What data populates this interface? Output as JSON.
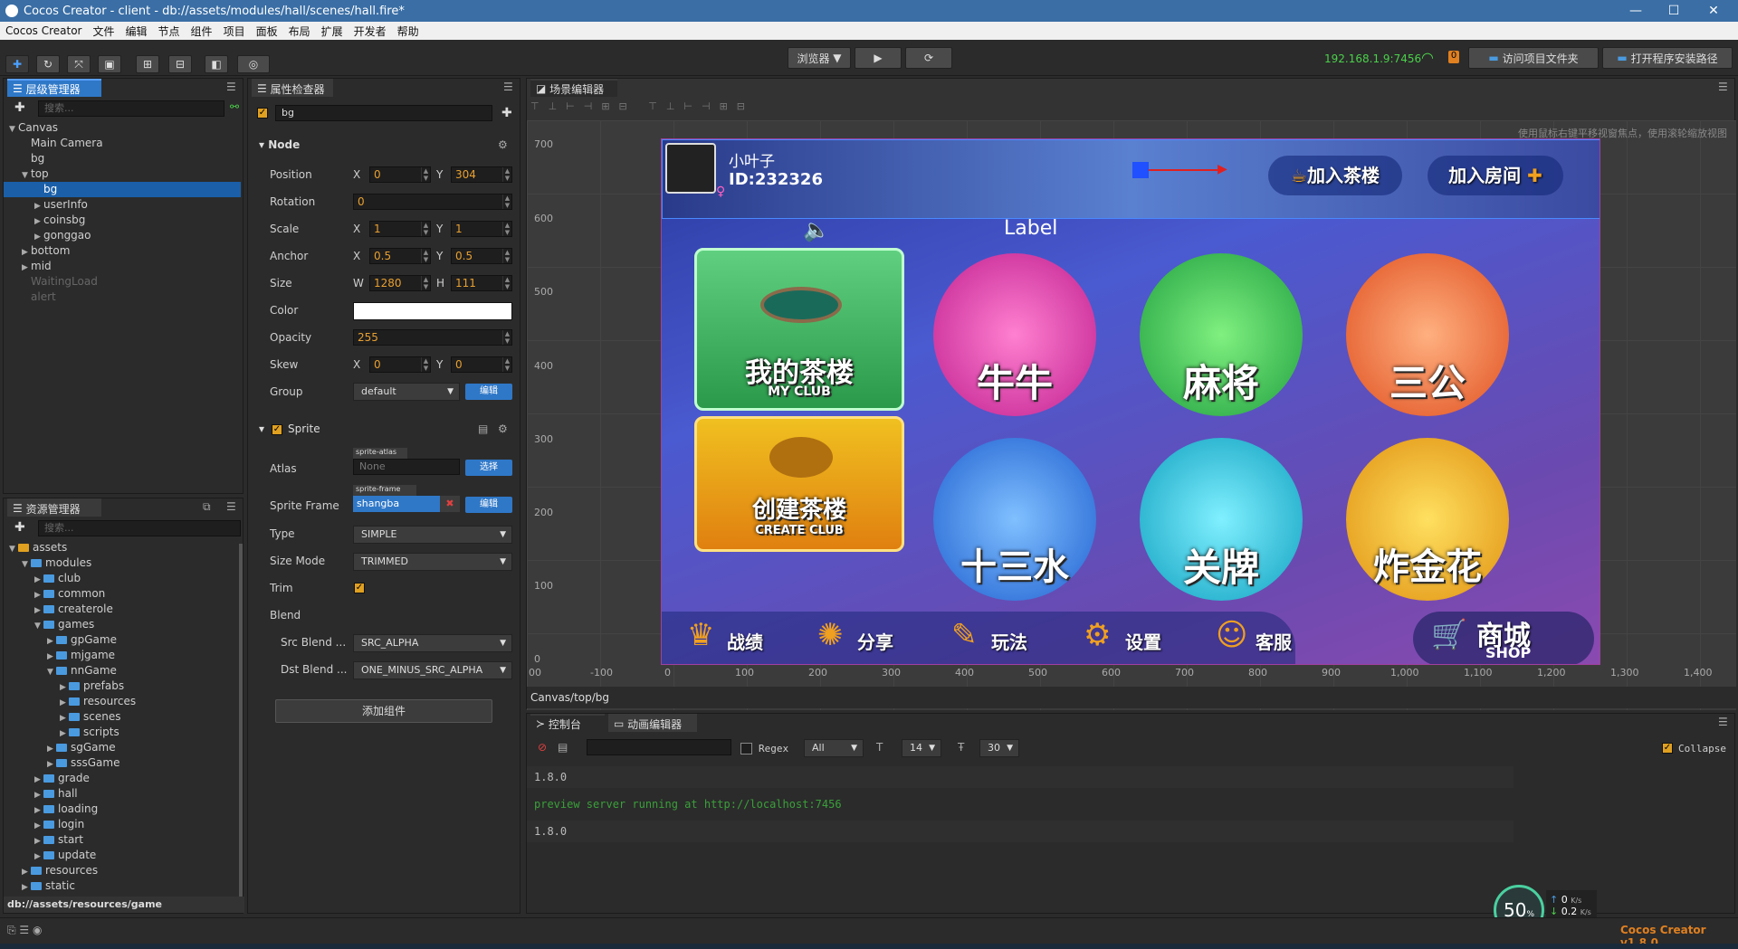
{
  "window": {
    "title": "Cocos Creator - client - db://assets/modules/hall/scenes/hall.fire*",
    "min": "—",
    "max": "☐",
    "close": "✕"
  },
  "menu": [
    "Cocos Creator",
    "文件",
    "编辑",
    "节点",
    "组件",
    "项目",
    "面板",
    "布局",
    "扩展",
    "开发者",
    "帮助"
  ],
  "toolbar": {
    "browser_label": "浏览器",
    "ip": "192.168.1.9:7456",
    "badge": "0",
    "visit_folder": "访问项目文件夹",
    "open_install": "打开程序安装路径"
  },
  "hierarchy": {
    "tab": "层级管理器",
    "search_placeholder": "搜索...",
    "items": [
      {
        "label": "Canvas",
        "arrow": "▼"
      },
      {
        "label": "Main Camera",
        "arrow": ""
      },
      {
        "label": "bg",
        "arrow": ""
      },
      {
        "label": "top",
        "arrow": "▼"
      },
      {
        "label": "bg",
        "arrow": ""
      },
      {
        "label": "userInfo",
        "arrow": "▶"
      },
      {
        "label": "coinsbg",
        "arrow": "▶"
      },
      {
        "label": "gonggao",
        "arrow": "▶"
      },
      {
        "label": "bottom",
        "arrow": "▶"
      },
      {
        "label": "mid",
        "arrow": "▶"
      },
      {
        "label": "WaitingLoad",
        "arrow": ""
      },
      {
        "label": "alert",
        "arrow": ""
      }
    ]
  },
  "assets": {
    "tab": "资源管理器",
    "search_placeholder": "搜索...",
    "path": "db://assets/resources/game",
    "items": [
      {
        "label": "assets",
        "arrow": "▼"
      },
      {
        "label": "modules",
        "arrow": "▼"
      },
      {
        "label": "club",
        "arrow": "▶"
      },
      {
        "label": "common",
        "arrow": "▶"
      },
      {
        "label": "createrole",
        "arrow": "▶"
      },
      {
        "label": "games",
        "arrow": "▼"
      },
      {
        "label": "gpGame",
        "arrow": "▶"
      },
      {
        "label": "mjgame",
        "arrow": "▶"
      },
      {
        "label": "nnGame",
        "arrow": "▼"
      },
      {
        "label": "prefabs",
        "arrow": "▶"
      },
      {
        "label": "resources",
        "arrow": "▶"
      },
      {
        "label": "scenes",
        "arrow": "▶"
      },
      {
        "label": "scripts",
        "arrow": "▶"
      },
      {
        "label": "sgGame",
        "arrow": "▶"
      },
      {
        "label": "sssGame",
        "arrow": "▶"
      },
      {
        "label": "grade",
        "arrow": "▶"
      },
      {
        "label": "hall",
        "arrow": "▶"
      },
      {
        "label": "loading",
        "arrow": "▶"
      },
      {
        "label": "login",
        "arrow": "▶"
      },
      {
        "label": "start",
        "arrow": "▶"
      },
      {
        "label": "update",
        "arrow": "▶"
      },
      {
        "label": "resources",
        "arrow": "▶"
      },
      {
        "label": "static",
        "arrow": "▶"
      }
    ]
  },
  "inspector": {
    "tab": "属性检查器",
    "node_name": "bg",
    "node_section": "Node",
    "position": {
      "label": "Position",
      "x": "0",
      "y": "304"
    },
    "rotation": {
      "label": "Rotation",
      "value": "0"
    },
    "scale": {
      "label": "Scale",
      "x": "1",
      "y": "1"
    },
    "anchor": {
      "label": "Anchor",
      "x": "0.5",
      "y": "0.5"
    },
    "size": {
      "label": "Size",
      "w": "1280",
      "h": "111"
    },
    "color": {
      "label": "Color",
      "value": "#ffffff"
    },
    "opacity": {
      "label": "Opacity",
      "value": "255"
    },
    "skew": {
      "label": "Skew",
      "x": "0",
      "y": "0"
    },
    "group": {
      "label": "Group",
      "value": "default",
      "edit": "编辑"
    },
    "sprite_section": "Sprite",
    "atlas": {
      "label": "Atlas",
      "tag": "sprite-atlas",
      "value": "None",
      "btn": "选择"
    },
    "sprite_frame": {
      "label": "Sprite Frame",
      "tag": "sprite-frame",
      "value": "shangba",
      "btn": "编辑"
    },
    "type": {
      "label": "Type",
      "value": "SIMPLE"
    },
    "size_mode": {
      "label": "Size Mode",
      "value": "TRIMMED"
    },
    "trim": {
      "label": "Trim"
    },
    "blend": {
      "label": "Blend"
    },
    "src_blend": {
      "label": "Src Blend ...",
      "value": "SRC_ALPHA"
    },
    "dst_blend": {
      "label": "Dst Blend ...",
      "value": "ONE_MINUS_SRC_ALPHA"
    },
    "add_component": "添加组件",
    "x": "X",
    "y": "Y",
    "w": "W",
    "h": "H"
  },
  "scene": {
    "tab": "场景编辑器",
    "hint": "使用鼠标右键平移视窗焦点，使用滚轮缩放视图",
    "breadcrumb": "Canvas/top/bg",
    "y_ticks": [
      "700",
      "600",
      "500",
      "400",
      "300",
      "200",
      "100",
      "0"
    ],
    "x_ticks": [
      "00",
      "-100",
      "0",
      "100",
      "200",
      "300",
      "400",
      "500",
      "600",
      "700",
      "800",
      "900",
      "1,000",
      "1,100",
      "1,200",
      "1,300",
      "1,400"
    ],
    "game": {
      "username": "小叶子",
      "user_id": "ID:232326",
      "join_teahouse": "加入茶楼",
      "join_room": "加入房间",
      "label_text": "Label",
      "my_club_cn": "我的茶楼",
      "my_club_en": "MY CLUB",
      "create_club_cn": "创建茶楼",
      "create_club_en": "CREATE CLUB",
      "games": [
        "牛牛",
        "麻将",
        "三公",
        "十三水",
        "关牌",
        "炸金花"
      ],
      "bottom": [
        "战绩",
        "分享",
        "玩法",
        "设置",
        "客服"
      ],
      "shop_cn": "商城",
      "shop_en": "SHOP"
    }
  },
  "console": {
    "tab1": "控制台",
    "tab2": "动画编辑器",
    "regex": "Regex",
    "filter": "All",
    "font_size": "14",
    "line_height": "30",
    "collapse": "Collapse",
    "lines": [
      "1.8.0",
      "preview server running at http://localhost:7456",
      "1.8.0"
    ]
  },
  "status": {
    "net_percent": "50",
    "up": "0",
    "down": "0.2",
    "unit": "K/s",
    "version": "Cocos Creator v1.8.0"
  }
}
